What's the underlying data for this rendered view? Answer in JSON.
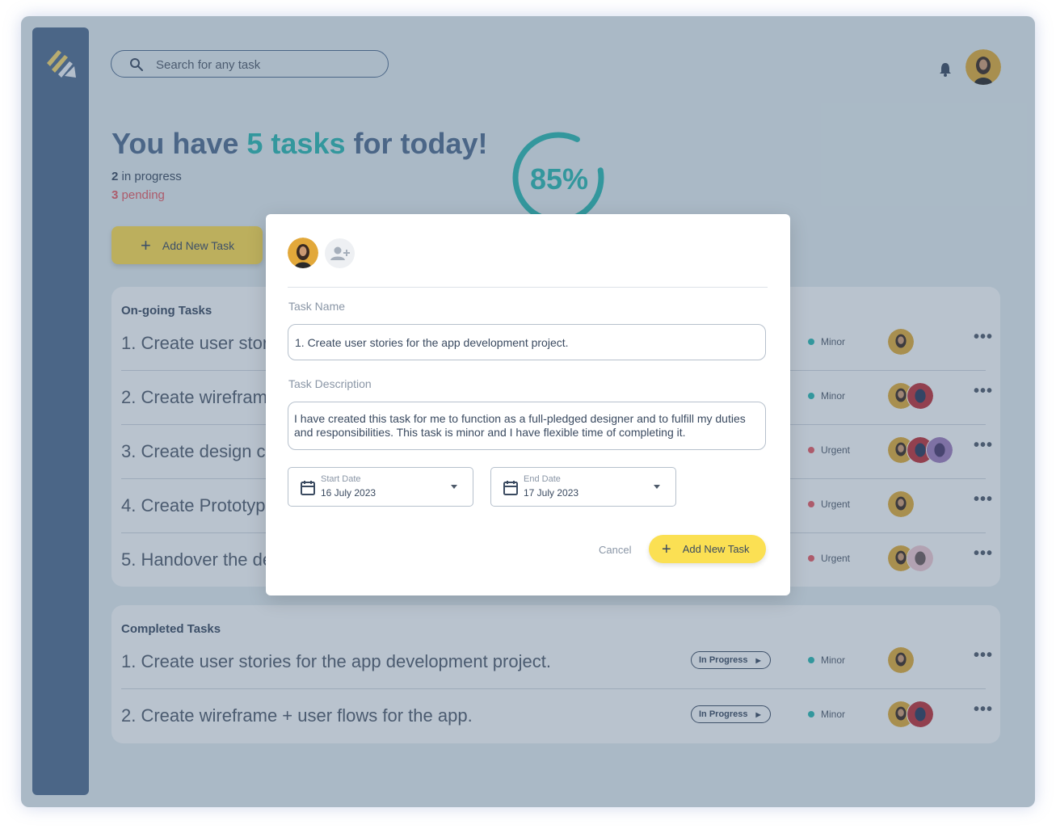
{
  "search": {
    "placeholder": "Search for any task"
  },
  "header": {
    "title_prefix": "You have ",
    "title_highlight": "5 tasks",
    "title_suffix": " for today!",
    "in_progress_count": "2",
    "in_progress_label": " in progress",
    "pending_count": "3",
    "pending_label": " pending",
    "progress_label": "85%",
    "progress_value": 85,
    "add_task_label": "Add New Task"
  },
  "ongoing": {
    "title": "On-going Tasks",
    "rows": [
      {
        "name": "1. Create user stories for the app development project.",
        "priority": "Minor",
        "priority_color": "#2bb3ad"
      },
      {
        "name": "2. Create wireframe + user flows for the app.",
        "priority": "Minor",
        "priority_color": "#2bb3ad"
      },
      {
        "name": "3. Create design components for the app.",
        "priority": "Urgent",
        "priority_color": "#e05a63"
      },
      {
        "name": "4. Create Prototype for the app.",
        "priority": "Urgent",
        "priority_color": "#e05a63"
      },
      {
        "name": "5. Handover the design to developers.",
        "priority": "Urgent",
        "priority_color": "#e05a63"
      }
    ]
  },
  "completed": {
    "title": "Completed Tasks",
    "rows": [
      {
        "name": "1. Create user stories for the app development project.",
        "status": "In Progress",
        "priority": "Minor",
        "priority_color": "#2bb3ad"
      },
      {
        "name": "2. Create wireframe + user flows for the app.",
        "status": "In Progress",
        "priority": "Minor",
        "priority_color": "#2bb3ad"
      }
    ]
  },
  "modal": {
    "task_name_label": "Task Name",
    "task_name_value": "1. Create user stories for the app development project.",
    "task_desc_label": "Task Description",
    "task_desc_value": "I have created this task for me to function as a full-pledged designer and to fulfill my duties and responsibilities. This task is minor and I have flexible time of completing it.",
    "start_label": "Start Date",
    "start_value": "16 July 2023",
    "end_label": "End Date",
    "end_value": "17 July 2023",
    "cancel_label": "Cancel",
    "submit_label": "Add New Task"
  },
  "colors": {
    "accent": "#2bb3ad",
    "primary": "#4e6a8d",
    "yellow": "#fbe053",
    "urgent": "#e05a63"
  },
  "icons": [
    "logo-icon",
    "search-icon",
    "bell-icon",
    "plus-icon",
    "add-user-icon",
    "calendar-icon",
    "caret-down-icon",
    "more-icon",
    "play-arrow-icon"
  ]
}
